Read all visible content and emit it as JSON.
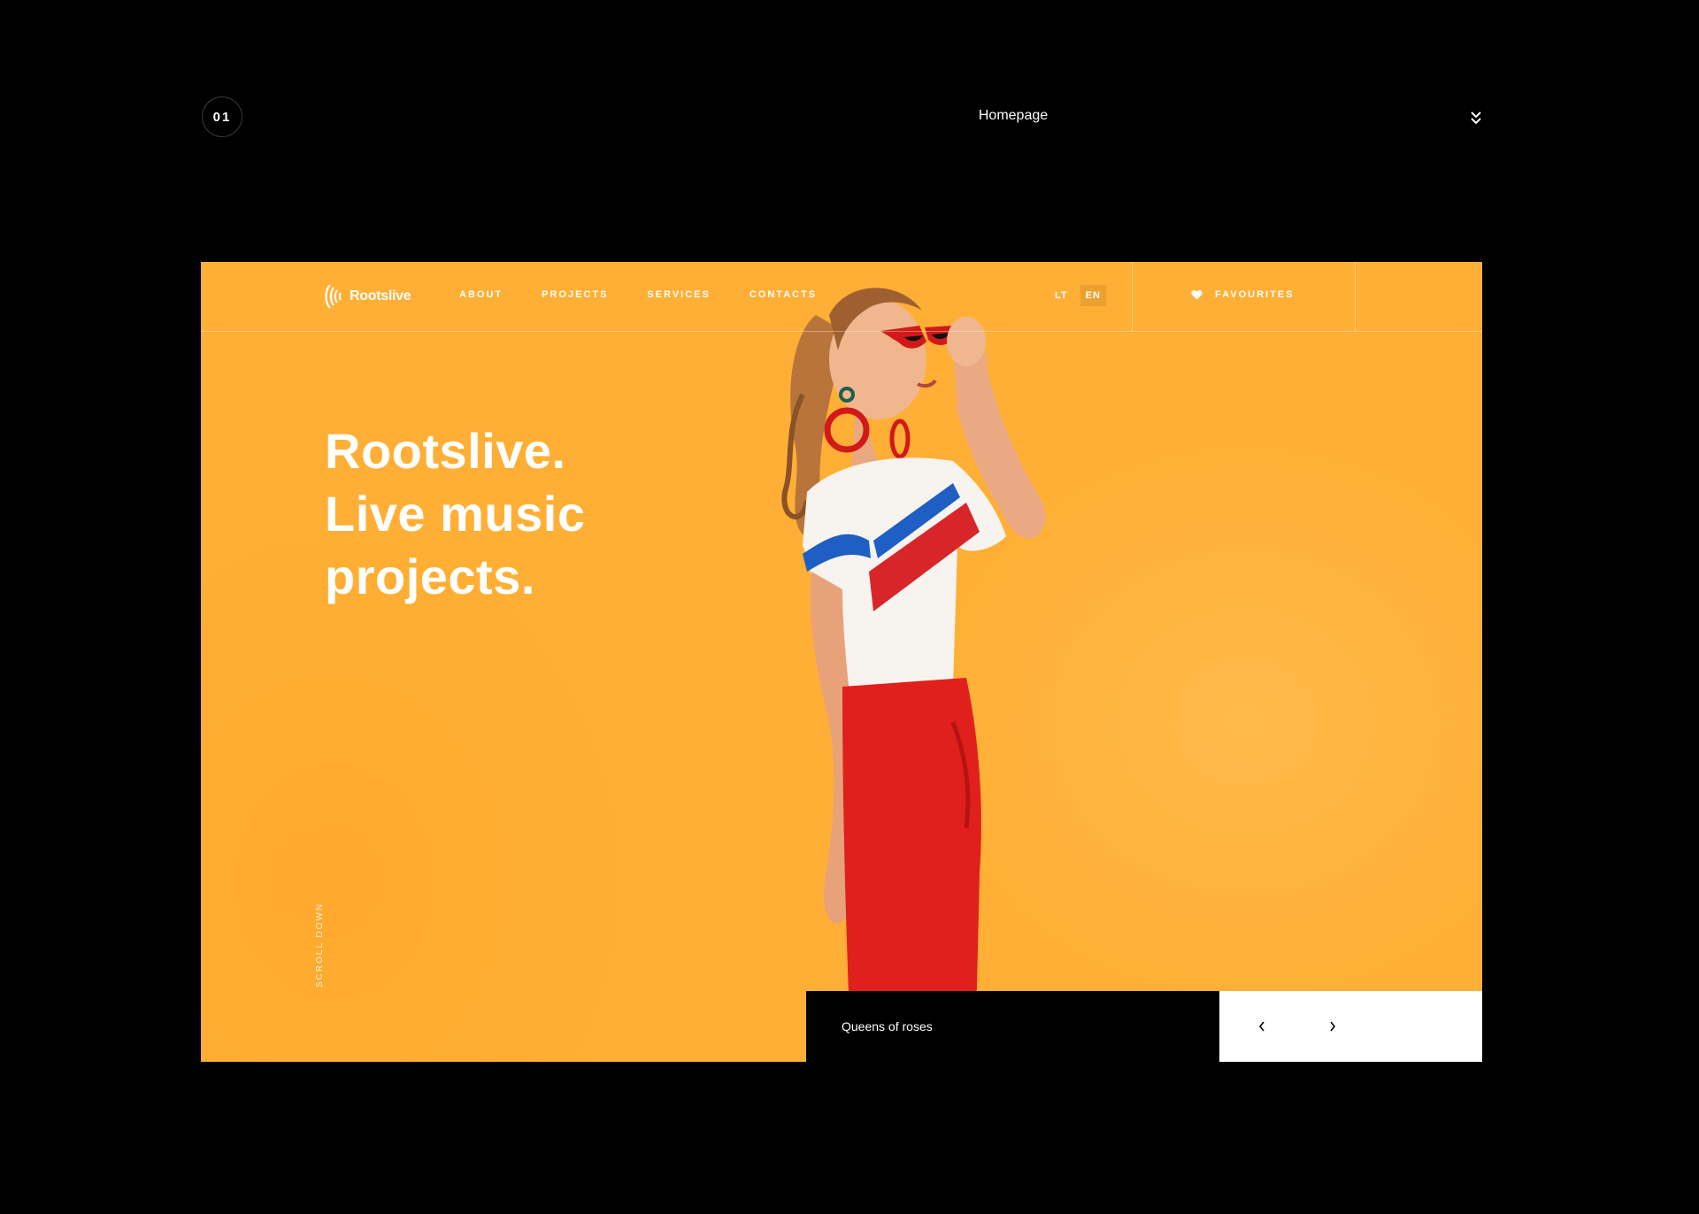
{
  "presentation": {
    "page_number": "01",
    "page_title": "Homepage",
    "menu_icon": "double-chevron-down-icon"
  },
  "site": {
    "logo_text": "Rootslive",
    "nav": [
      "ABOUT",
      "PROJECTS",
      "SERVICES",
      "CONTACTS"
    ],
    "languages": [
      {
        "code": "LT",
        "active": false
      },
      {
        "code": "EN",
        "active": true
      }
    ],
    "favourites_label": "FAVOURITES",
    "favourites_icon": "heart-icon"
  },
  "hero": {
    "title_lines": [
      "Rootslive.",
      "Live music",
      "projects."
    ],
    "scroll_label": "SCROLL DOWN",
    "caption": "Queens of roses",
    "prev_icon": "chevron-left-icon",
    "next_icon": "chevron-right-icon"
  },
  "colors": {
    "background": "#000000",
    "accent": "#ffaf35",
    "text": "#ffffff"
  }
}
